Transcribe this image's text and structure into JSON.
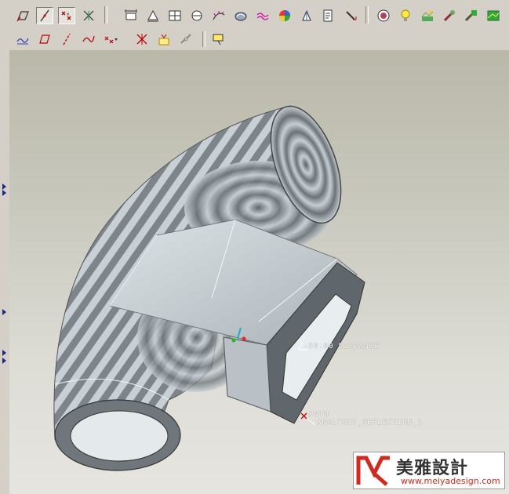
{
  "toolbar_top": {
    "buttons": [
      {
        "id": "sketch-plane",
        "icon": "sketch-plane-icon"
      },
      {
        "id": "sketch-line-view",
        "icon": "line-view-icon"
      },
      {
        "id": "points-x",
        "icon": "datum-points-icon"
      },
      {
        "id": "csys-toggle",
        "icon": "csys-icon"
      },
      {
        "id": "measure-distance",
        "icon": "measure-distance-icon"
      },
      {
        "id": "measure-area",
        "icon": "measure-area-icon"
      },
      {
        "id": "mass-props",
        "icon": "mass-properties-icon"
      },
      {
        "id": "measure-angle",
        "icon": "angle-icon"
      },
      {
        "id": "curvature",
        "icon": "curvature-icon"
      },
      {
        "id": "section",
        "icon": "section-icon"
      },
      {
        "id": "offset-curve",
        "icon": "offset-icon"
      },
      {
        "id": "shaded-curvature",
        "icon": "shaded-curvature-icon"
      },
      {
        "id": "draft-check",
        "icon": "draft-icon"
      },
      {
        "id": "dihedral",
        "icon": "dihedral-icon"
      },
      {
        "id": "probe",
        "icon": "probe-icon"
      },
      {
        "id": "reflection",
        "icon": "reflection-icon"
      },
      {
        "id": "light-bulb",
        "icon": "light-bulb-icon"
      },
      {
        "id": "scene",
        "icon": "scene-icon"
      },
      {
        "id": "appearance",
        "icon": "appearance-icon"
      },
      {
        "id": "render-settings",
        "icon": "render-settings-icon"
      }
    ]
  },
  "toolbar_bottom": {
    "buttons": [
      {
        "id": "graph",
        "icon": "graph-icon"
      },
      {
        "id": "plane-sketch",
        "icon": "plane-icon"
      },
      {
        "id": "axis-line",
        "icon": "axis-icon"
      },
      {
        "id": "curve",
        "icon": "curve-icon"
      },
      {
        "id": "point-menu",
        "icon": "point-dropdown-icon"
      },
      {
        "id": "csys",
        "icon": "coordinate-system-icon"
      },
      {
        "id": "analysis",
        "icon": "analysis-icon"
      },
      {
        "id": "link",
        "icon": "link-icon"
      },
      {
        "id": "note",
        "icon": "note-icon"
      }
    ]
  },
  "viewport": {
    "annotations": {
      "distance": "-50.00  DISTANCE",
      "point": "PNT0",
      "analysis": "ANALYSIS_REFLECTION_1"
    }
  },
  "watermark": {
    "chinese": "美雅設計",
    "url": "www.meiyadesign.com",
    "brand_color": "#d02a1f"
  },
  "colors": {
    "toolbar_bg": "#d4d0c8",
    "viewport_top": "#b9b8a9",
    "viewport_bottom": "#e6e5e0",
    "model_stripe": "#7f868b",
    "model_light": "#c7ced3"
  }
}
